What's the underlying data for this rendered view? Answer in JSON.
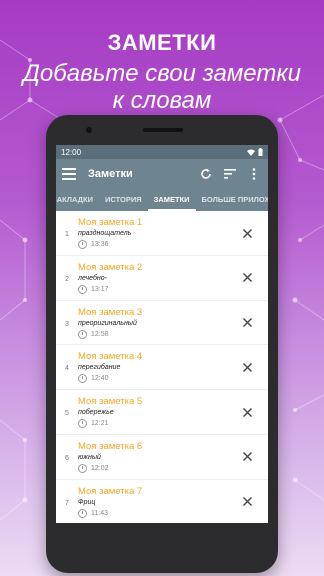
{
  "promo": {
    "title": "ЗАМЕТКИ",
    "subtitle_line1": "Добавьте свои заметки",
    "subtitle_line2": "к словам"
  },
  "status_bar": {
    "time": "12:00"
  },
  "toolbar": {
    "title": "Заметки",
    "icons": [
      "menu-icon",
      "refresh-icon",
      "sort-icon",
      "more-vert-icon"
    ]
  },
  "tabs": [
    {
      "label": "ЗАКЛАДКИ"
    },
    {
      "label": "ИСТОРИЯ"
    },
    {
      "label": "ЗАМЕТКИ"
    },
    {
      "label": "БОЛЬШЕ ПРИЛОЖЕНИЙ"
    }
  ],
  "notes": [
    {
      "index": "1",
      "title": "Моя заметка 1",
      "word": "празднощатель",
      "time": "13:36"
    },
    {
      "index": "2",
      "title": "Моя заметка 2",
      "word": "лечебно-",
      "time": "13:17"
    },
    {
      "index": "3",
      "title": "Моя заметка 3",
      "word": "преоригинальный",
      "time": "12:58"
    },
    {
      "index": "4",
      "title": "Моя заметка 4",
      "word": "перегибание",
      "time": "12:40"
    },
    {
      "index": "5",
      "title": "Моя заметка 5",
      "word": "побережье",
      "time": "12:21"
    },
    {
      "index": "6",
      "title": "Моя заметка 6",
      "word": "южный",
      "time": "12:02"
    },
    {
      "index": "7",
      "title": "Моя заметка 7",
      "word": "Фриц",
      "time": "11:43"
    }
  ],
  "colors": {
    "accent": "#f5a623",
    "toolbar": "#6f8491",
    "statusbar": "#5a6d7a"
  }
}
